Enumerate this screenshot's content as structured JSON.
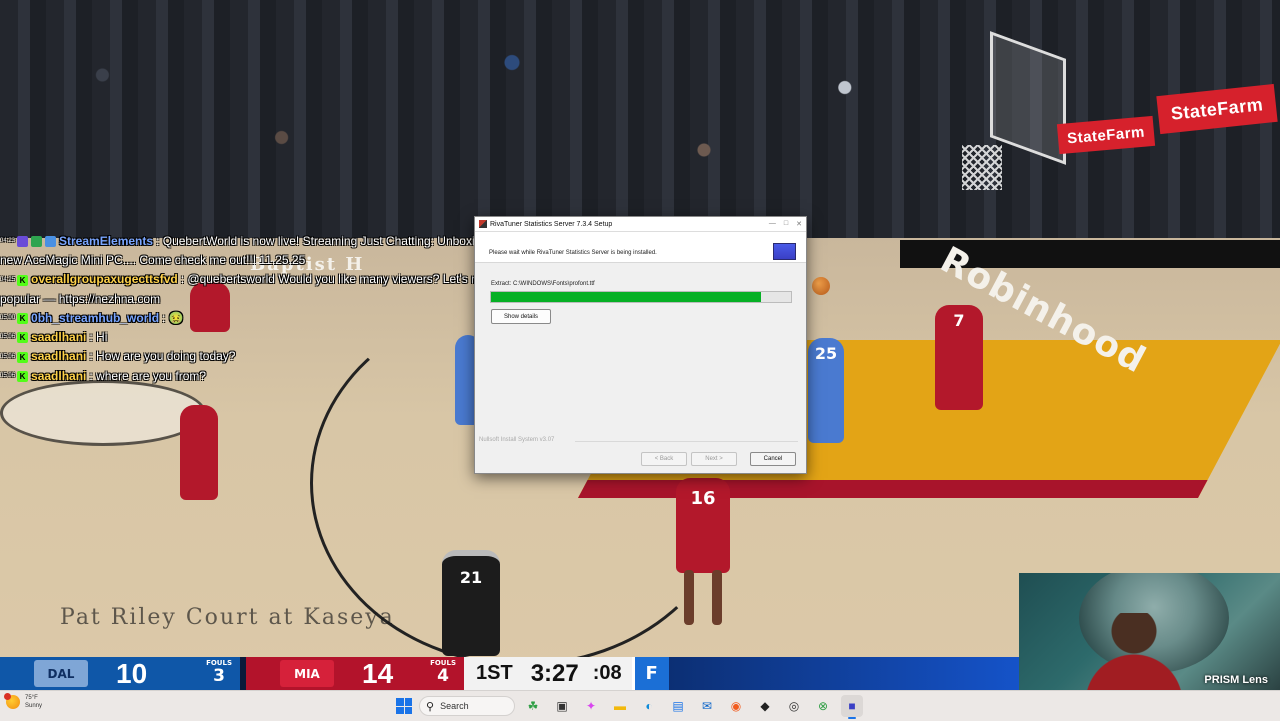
{
  "chat": [
    {
      "time": "04:23",
      "badges": [
        "p",
        "g",
        "b"
      ],
      "user": "StreamElements",
      "user_color": "#7aa6ff",
      "message": ": QuebertWorld is now live! Streaming Just Chatting: Unboxing my",
      "continuation": "new AceMagic Mini PC.... Come check me out!!! 11.25.25"
    },
    {
      "time": "04:25",
      "badges": [
        "k"
      ],
      "user": "overallgroupaxugecttsfvd",
      "user_color": "#ffd24a",
      "message": ": @quebertsworld Would you like many viewers? Let's make you",
      "continuation": "popular — https://nezhna.com"
    },
    {
      "time": "05:00",
      "badges": [
        "k"
      ],
      "user": "0bh_streamhub_world",
      "user_color": "#7aa6ff",
      "message": ": 🤢",
      "continuation": ""
    },
    {
      "time": "05:06",
      "badges": [
        "k"
      ],
      "user": "saadlhani",
      "user_color": "#ffd24a",
      "message": ": Hi",
      "continuation": ""
    },
    {
      "time": "05:06",
      "badges": [
        "k"
      ],
      "user": "saadlhani",
      "user_color": "#ffd24a",
      "message": ": How are you doing today?",
      "continuation": ""
    },
    {
      "time": "05:06",
      "badges": [
        "k"
      ],
      "user": "saadlhani",
      "user_color": "#ffd24a",
      "message": ": where are you from?",
      "continuation": ""
    }
  ],
  "installer": {
    "title": "RivaTuner Statistics Server 7.3.4 Setup",
    "header_text": "Please wait while RivaTuner Statistics Server is being installed.",
    "current_path": "Extract: C:\\WINDOWS\\Fonts\\profont.ttf",
    "progress": 0.9,
    "show_details": "Show details",
    "nsis": "Nullsoft Install System v3.07",
    "back": "< Back",
    "next": "Next >",
    "cancel": "Cancel"
  },
  "court": {
    "baptist": "Baptist H",
    "robinhood": "Robinhood",
    "bottom_text": "Pat Riley Court at Kaseya",
    "statefarm": "StateFarm"
  },
  "players": {
    "p7": "7",
    "p25": "25",
    "p16": "16",
    "ref": "21"
  },
  "scoreboard": {
    "away_logo": "DAL",
    "away_score": "10",
    "away_fouls_label": "FOULS",
    "away_fouls": "3",
    "home_logo": "MIA",
    "home_score": "14",
    "home_fouls_label": "FOULS",
    "home_fouls": "4",
    "period": "1ST",
    "clock": "3:27",
    "shot_clock": ":08",
    "sponsor_logo": "F"
  },
  "webcam": {
    "label": "PRISM Lens"
  },
  "taskbar": {
    "temperature": "75°F",
    "condition": "Sunny",
    "search_placeholder": "Search",
    "apps": [
      {
        "name": "widgets-app-icon",
        "glyph": "☘",
        "color": "#2e9e44"
      },
      {
        "name": "task-view-icon",
        "glyph": "▣",
        "color": "#333"
      },
      {
        "name": "copilot-icon",
        "glyph": "✦",
        "color": "#d946ef"
      },
      {
        "name": "file-explorer-icon",
        "glyph": "▬",
        "color": "#f2b90d"
      },
      {
        "name": "edge-icon",
        "glyph": "◐",
        "color": "#0f8bd9"
      },
      {
        "name": "store-icon",
        "glyph": "▤",
        "color": "#1a73e8"
      },
      {
        "name": "outlook-icon",
        "glyph": "✉",
        "color": "#0a64c9"
      },
      {
        "name": "firefox-icon",
        "glyph": "◉",
        "color": "#f25c1f"
      },
      {
        "name": "app-icon-dark",
        "glyph": "◆",
        "color": "#222"
      },
      {
        "name": "obs-icon",
        "glyph": "◎",
        "color": "#333"
      },
      {
        "name": "xbox-icon",
        "glyph": "⊗",
        "color": "#2e9e44"
      },
      {
        "name": "installer-taskbar-icon",
        "glyph": "■",
        "color": "#3a3fc5",
        "active": true
      }
    ]
  }
}
